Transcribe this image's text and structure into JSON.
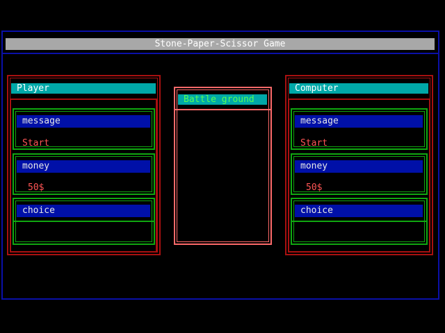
{
  "title": "Stone-Paper-Scissor Game",
  "player": {
    "header": "Player",
    "message_label": "message",
    "message_value": "Start",
    "money_label": "money",
    "money_value": "50$",
    "choice_label": "choice",
    "choice_value": ""
  },
  "battle": {
    "header": "Battle ground"
  },
  "computer": {
    "header": "Computer",
    "message_label": "message",
    "message_value": "Start",
    "money_label": "money",
    "money_value": "50$",
    "choice_label": "choice",
    "choice_value": ""
  },
  "colors": {
    "background": "#000000",
    "outer_frame": "#0a10a8",
    "panel_frame": "#a81010",
    "field_frame": "#10a810",
    "battle_frame": "#ff6a6a",
    "title_bar": "#a8a8a8",
    "header_bar": "#00a8a8",
    "label_bar": "#0010a8",
    "value_text": "#ff5555"
  }
}
